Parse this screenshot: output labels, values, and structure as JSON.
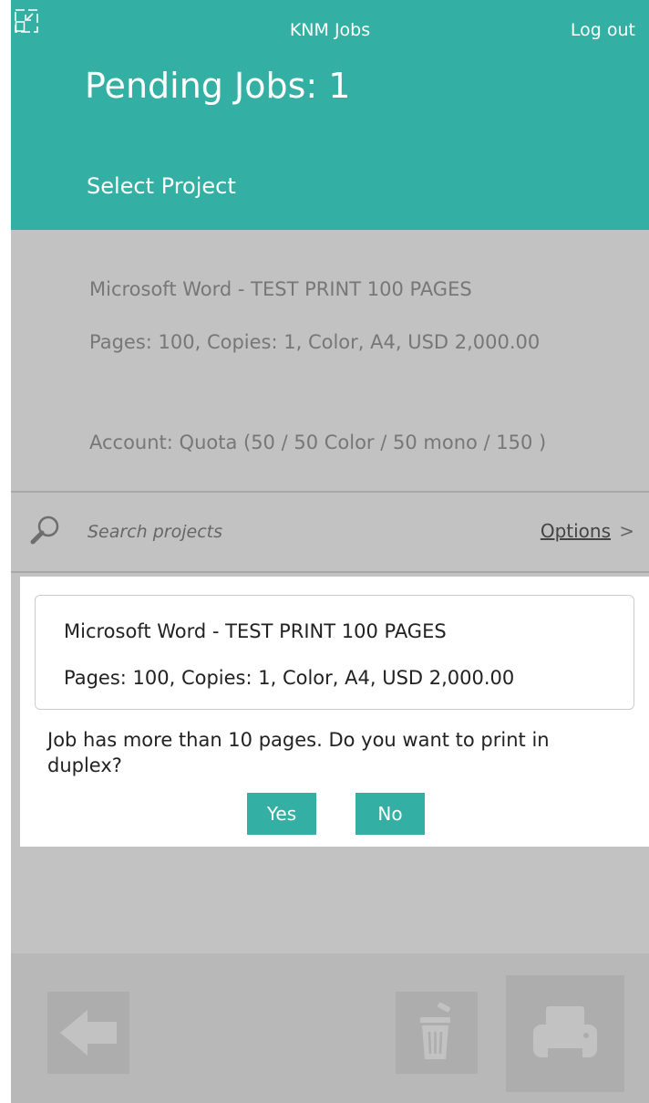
{
  "header": {
    "app_title": "KNM Jobs",
    "logout_label": "Log out",
    "page_title": "Pending Jobs: 1",
    "select_project_label": "Select Project",
    "background_color": "#33b0a3"
  },
  "job_summary": {
    "title": "Microsoft Word - TEST PRINT 100 PAGES",
    "details": "Pages: 100, Copies: 1, Color, A4, USD 2,000.00",
    "account": "Account: Quota (50  / 50 Color / 50 mono / 150 )"
  },
  "search": {
    "placeholder": "Search projects",
    "options_label": "Options",
    "options_arrow": ">"
  },
  "dialog": {
    "job_title": "Microsoft Word - TEST PRINT 100 PAGES",
    "job_details": "Pages: 100, Copies: 1, Color, A4, USD 2,000.00",
    "question": "Job has more than 10 pages. Do you want to print in duplex?",
    "yes_label": "Yes",
    "no_label": "No"
  },
  "footer": {
    "icons": [
      "back-arrow-icon",
      "trash-icon",
      "printer-icon"
    ]
  },
  "colors": {
    "accent": "#33b0a3",
    "panel_gray": "#c2c2c2",
    "footer_gray": "#b8b8b8"
  }
}
